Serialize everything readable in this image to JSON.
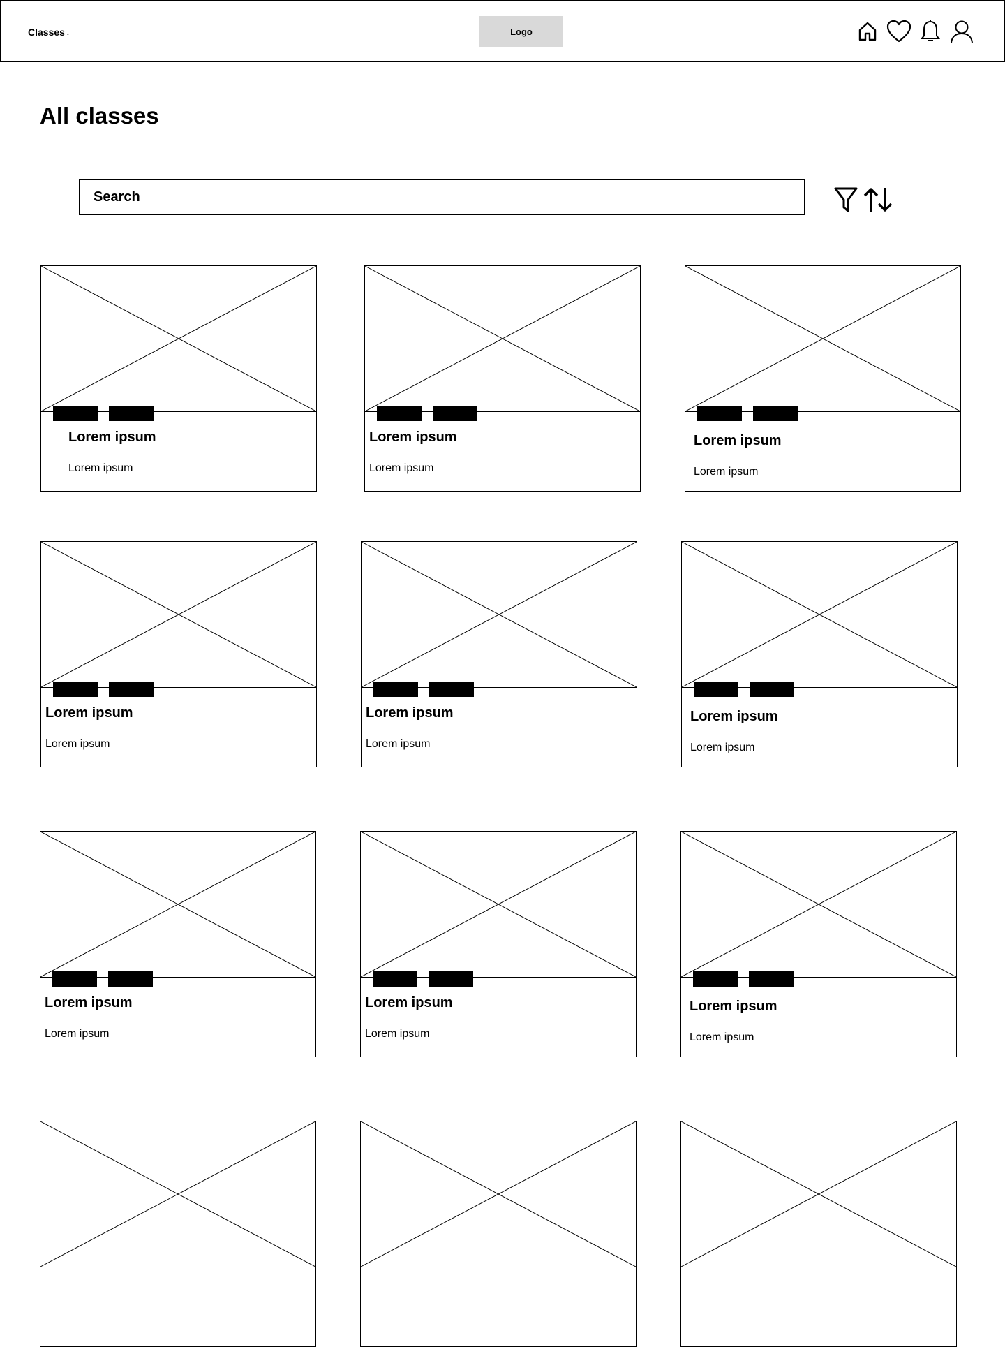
{
  "header": {
    "nav_label": "Classes",
    "nav_chevron": "⌄",
    "logo": "Logo",
    "icons": [
      "home-icon",
      "heart-icon",
      "bell-icon",
      "user-icon"
    ]
  },
  "page_title": "All classes",
  "search": {
    "placeholder": "Search"
  },
  "toolbar_icons": [
    "filter-icon",
    "sort-icon"
  ],
  "cards": [
    {
      "title": "Lorem ipsum",
      "subtitle": "Lorem ipsum"
    },
    {
      "title": "Lorem ipsum",
      "subtitle": "Lorem ipsum"
    },
    {
      "title": "Lorem ipsum",
      "subtitle": "Lorem ipsum"
    },
    {
      "title": "Lorem ipsum",
      "subtitle": "Lorem ipsum"
    },
    {
      "title": "Lorem ipsum",
      "subtitle": "Lorem ipsum"
    },
    {
      "title": "Lorem ipsum",
      "subtitle": "Lorem ipsum"
    },
    {
      "title": "Lorem ipsum",
      "subtitle": "Lorem ipsum"
    },
    {
      "title": "Lorem ipsum",
      "subtitle": "Lorem ipsum"
    },
    {
      "title": "Lorem ipsum",
      "subtitle": "Lorem ipsum"
    },
    {
      "title": "",
      "subtitle": ""
    },
    {
      "title": "",
      "subtitle": ""
    },
    {
      "title": "",
      "subtitle": ""
    }
  ]
}
